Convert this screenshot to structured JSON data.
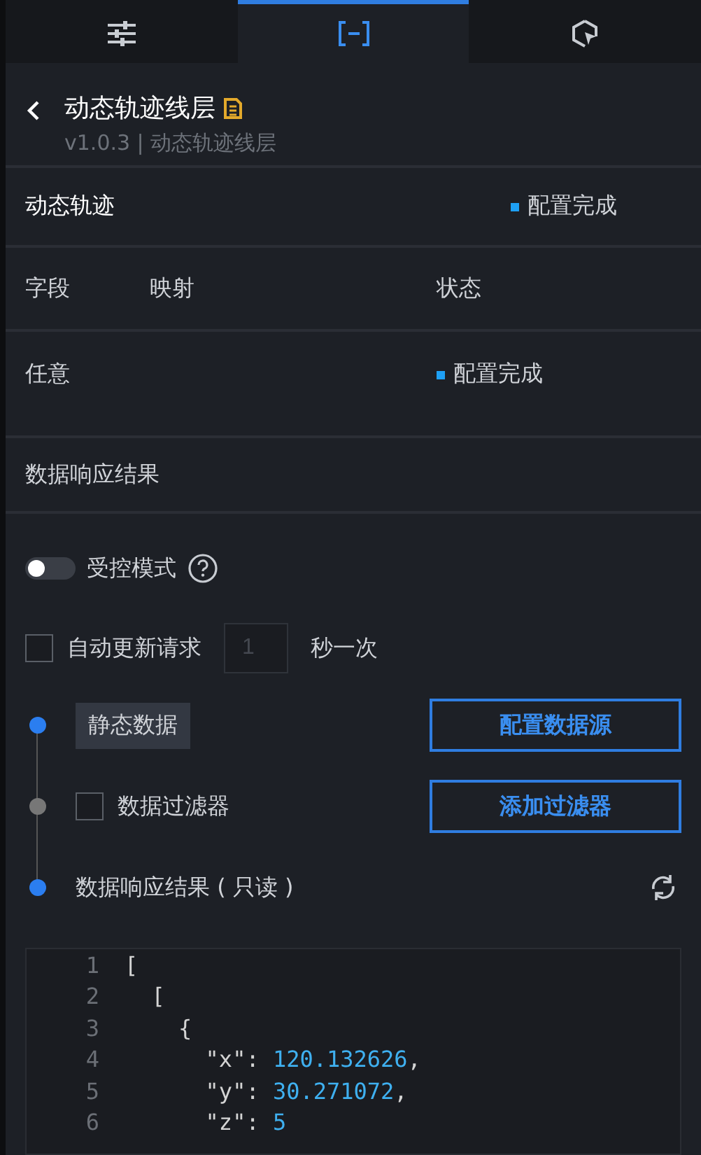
{
  "tabs": [
    {
      "kind": "sliders",
      "selected": false
    },
    {
      "kind": "brackets",
      "selected": true
    },
    {
      "kind": "cursor",
      "selected": false
    }
  ],
  "header": {
    "title": "动态轨迹线层",
    "version": "v1.0.3 | 动态轨迹线层"
  },
  "data_section": {
    "title": "动态轨迹",
    "status": "配置完成"
  },
  "field_table": {
    "columns": [
      "字段",
      "映射",
      "状态"
    ],
    "rows": [
      {
        "field": "任意",
        "status": "配置完成"
      }
    ]
  },
  "response_title": "数据响应结果",
  "controlled_mode": {
    "label": "受控模式",
    "on": false
  },
  "auto_update": {
    "label": "自动更新请求",
    "checked": false,
    "placeholder": "1",
    "suffix": "秒一次"
  },
  "pipeline": [
    {
      "kind": "source",
      "label": "静态数据",
      "button": "配置数据源",
      "active": true
    },
    {
      "kind": "filter",
      "label": "数据过滤器",
      "checked": false,
      "button": "添加过滤器",
      "active": false
    },
    {
      "kind": "result",
      "label": "数据响应结果 ( 只读 )",
      "active": true
    }
  ],
  "code_lines": [
    {
      "number": "1",
      "tokens": [
        {
          "kind": "punct",
          "text": "["
        }
      ]
    },
    {
      "number": "2",
      "tokens": [
        {
          "kind": "punct",
          "text": "  ["
        }
      ]
    },
    {
      "number": "3",
      "tokens": [
        {
          "kind": "punct",
          "text": "    {"
        }
      ]
    },
    {
      "number": "4",
      "tokens": [
        {
          "kind": "key",
          "text": "      \"x\": "
        },
        {
          "kind": "number",
          "text": "120.132626"
        },
        {
          "kind": "punct",
          "text": ","
        }
      ]
    },
    {
      "number": "5",
      "tokens": [
        {
          "kind": "key",
          "text": "      \"y\": "
        },
        {
          "kind": "number",
          "text": "30.271072"
        },
        {
          "kind": "punct",
          "text": ","
        }
      ]
    },
    {
      "number": "6",
      "tokens": [
        {
          "kind": "key",
          "text": "      \"z\": "
        },
        {
          "kind": "number",
          "text": "5"
        }
      ]
    }
  ]
}
